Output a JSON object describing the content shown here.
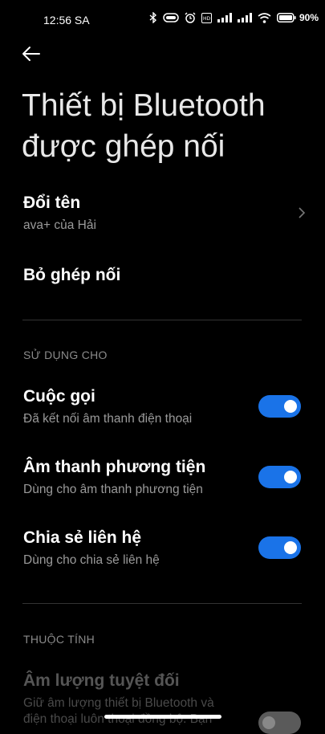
{
  "status": {
    "time": "12:56 SA",
    "battery": "90%"
  },
  "page": {
    "title": "Thiết bị Bluetooth được ghép nối"
  },
  "rename": {
    "label": "Đổi tên",
    "value": "ava+ của Hải"
  },
  "unpair": {
    "label": "Bỏ ghép nối"
  },
  "use_for": {
    "header": "SỬ DỤNG CHO",
    "items": [
      {
        "label": "Cuộc gọi",
        "sub": "Đã kết nối âm thanh điện thoại",
        "enabled": true
      },
      {
        "label": "Âm thanh phương tiện",
        "sub": "Dùng cho âm thanh phương tiện",
        "enabled": true
      },
      {
        "label": "Chia sẻ liên hệ",
        "sub": "Dùng cho chia sẻ liên hệ",
        "enabled": true
      }
    ]
  },
  "properties": {
    "header": "THUỘC TÍNH",
    "absolute_volume": {
      "label": "Âm lượng tuyệt đối",
      "sub": "Giữ âm lượng thiết bị Bluetooth và điện thoại luôn thoại đồng bộ. Bạn",
      "enabled": false
    }
  },
  "colors": {
    "accent": "#1a73e8",
    "background": "#000000"
  }
}
